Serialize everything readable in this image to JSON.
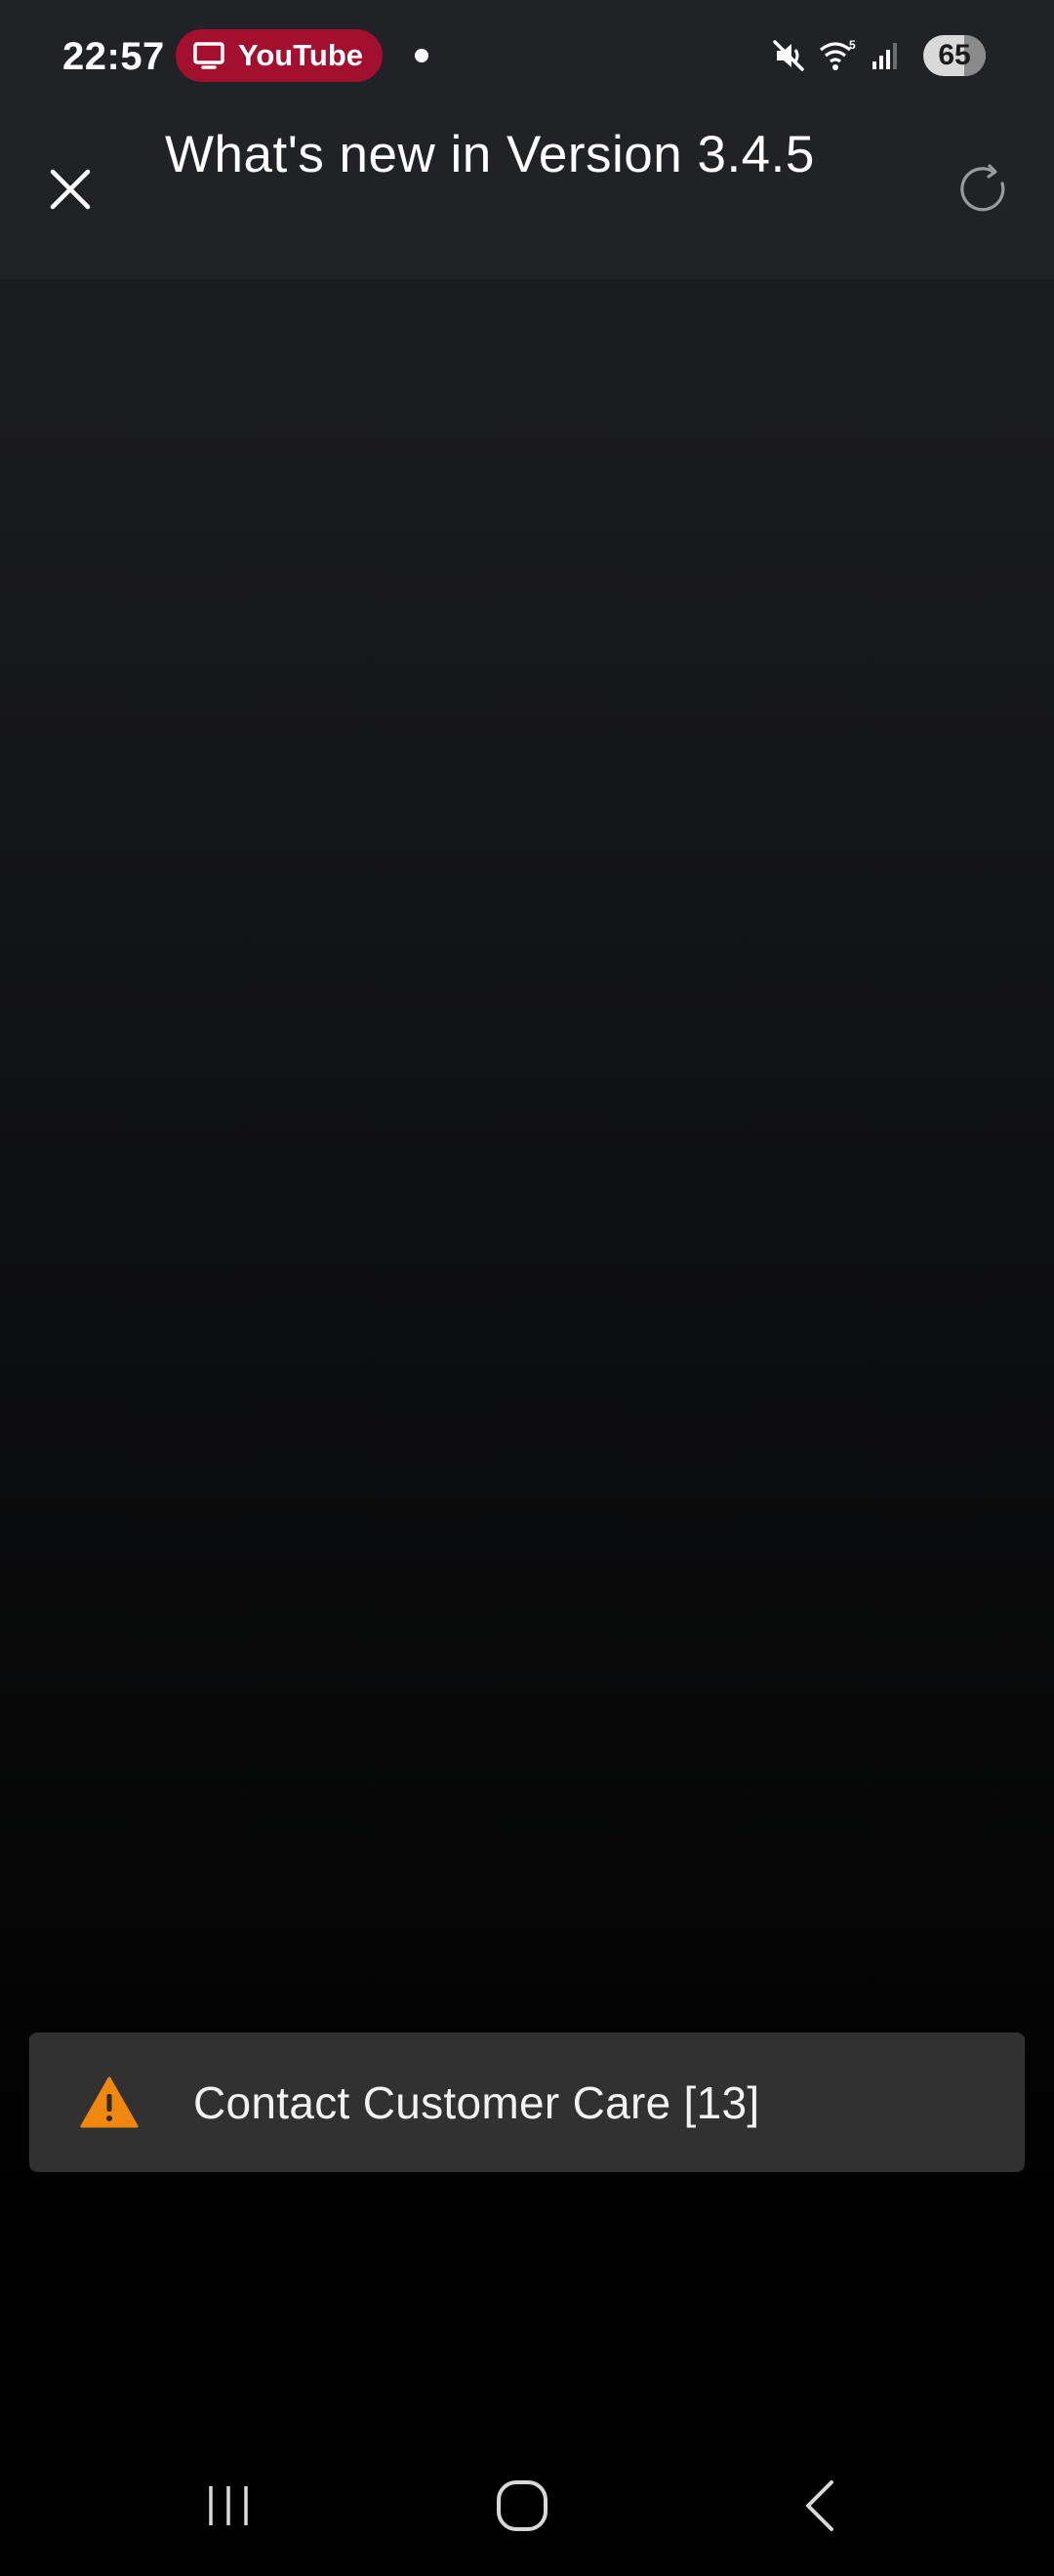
{
  "status_bar": {
    "time": "22:57",
    "cast_app": "YouTube",
    "battery_level": "65",
    "battery_fraction": 0.65,
    "icons": [
      "tv-icon",
      "mute-icon",
      "wifi-icon",
      "signal-icon",
      "battery-icon"
    ],
    "wifi_badge": "5"
  },
  "header": {
    "title": "What's new in Version 3.4.5",
    "close_icon": "close-icon",
    "reload_icon": "reload-icon"
  },
  "snackbar": {
    "icon": "warning-icon",
    "message": "Contact Customer Care [13]",
    "icon_color": "#f0870f"
  },
  "nav_bar": {
    "items": [
      "recents-icon",
      "home-icon",
      "back-icon"
    ]
  },
  "colors": {
    "header_bg": "#202226",
    "cast_pill": "#a30f2e",
    "snackbar_bg": "#313131"
  }
}
